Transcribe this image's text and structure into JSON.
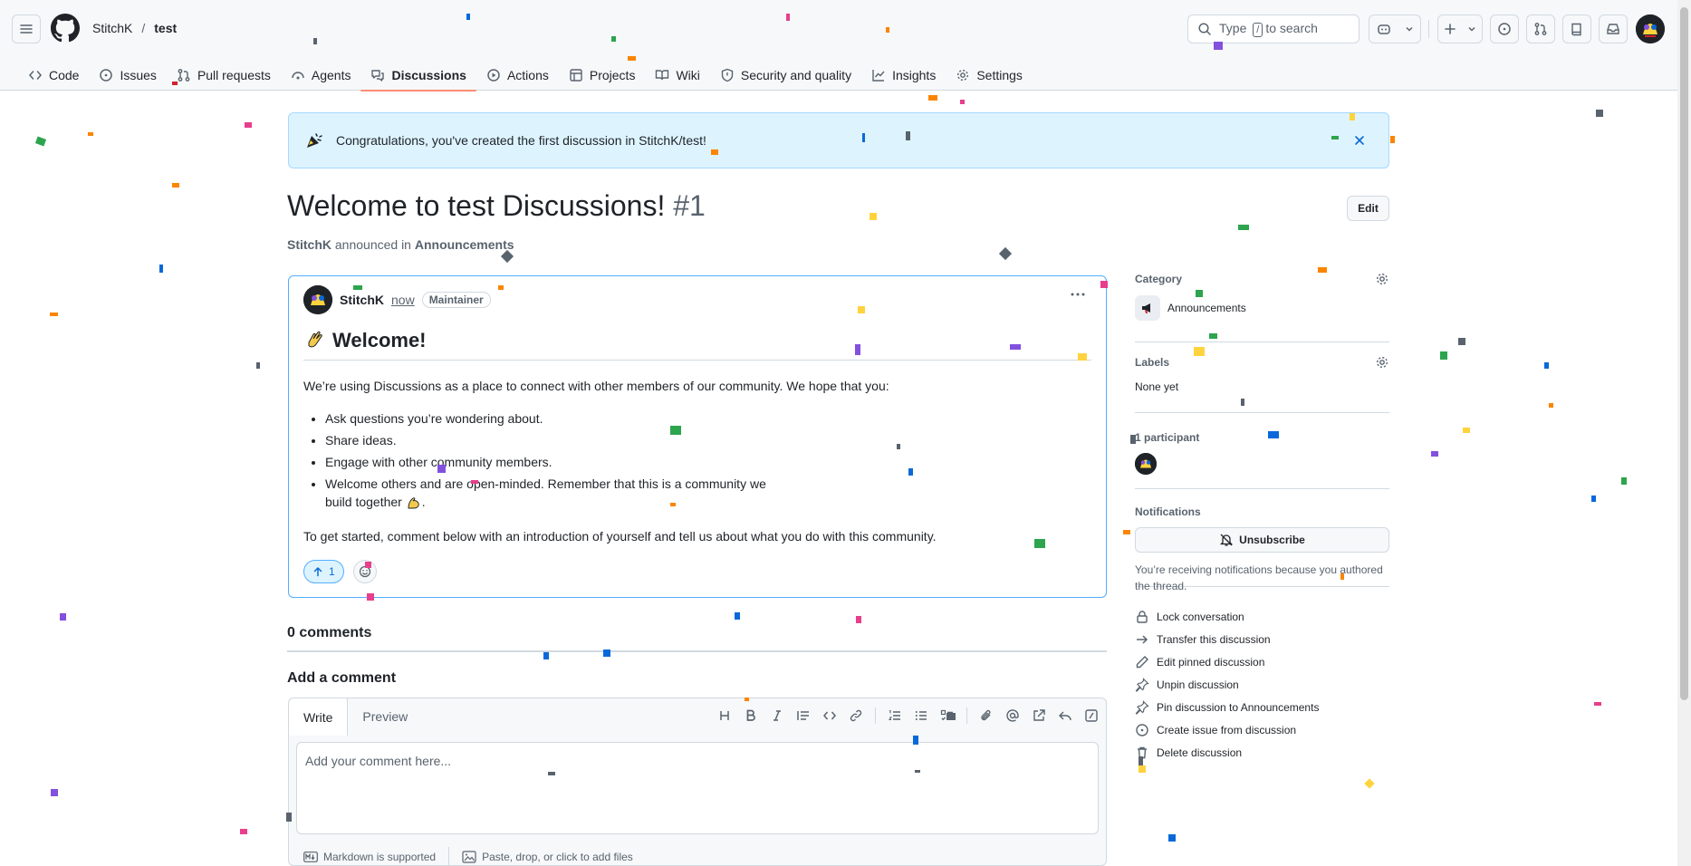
{
  "header": {
    "owner": "StitchK",
    "separator": "/",
    "repo": "test",
    "search": {
      "prefix": "Type",
      "key": "/",
      "suffix": "to search"
    }
  },
  "tabs": [
    {
      "label": "Code",
      "icon": "code-icon"
    },
    {
      "label": "Issues",
      "icon": "issue-icon"
    },
    {
      "label": "Pull requests",
      "icon": "pull-request-icon"
    },
    {
      "label": "Agents",
      "icon": "agent-icon"
    },
    {
      "label": "Discussions",
      "icon": "discussion-icon",
      "active": true
    },
    {
      "label": "Actions",
      "icon": "play-icon"
    },
    {
      "label": "Projects",
      "icon": "table-icon"
    },
    {
      "label": "Wiki",
      "icon": "book-icon"
    },
    {
      "label": "Security and quality",
      "icon": "shield-icon"
    },
    {
      "label": "Insights",
      "icon": "graph-icon"
    },
    {
      "label": "Settings",
      "icon": "gear-icon"
    }
  ],
  "banner": {
    "text": "Congratulations, you've created the first discussion in StitchK/test!"
  },
  "discussion": {
    "title": "Welcome to test Discussions!",
    "number": "#1",
    "edit_label": "Edit",
    "author": "StitchK",
    "action_text": "announced in",
    "category": "Announcements"
  },
  "post": {
    "author": "StitchK",
    "time": "now",
    "badge": "Maintainer",
    "heading": "Welcome!",
    "intro": "We’re using Discussions as a place to connect with other members of our community. We hope that you:",
    "bullets": [
      "Ask questions you’re wondering about.",
      "Share ideas.",
      "Engage with other community members.",
      "Welcome others and are open-minded. Remember that this is a community we build together"
    ],
    "outro": "To get started, comment below with an introduction of yourself and tell us about what you do with this community.",
    "upvotes": "1"
  },
  "comments": {
    "count_label": "0 comments",
    "add_label": "Add a comment",
    "write_tab": "Write",
    "preview_tab": "Preview",
    "placeholder": "Add your comment here...",
    "markdown_note": "Markdown is supported",
    "attach_note": "Paste, drop, or click to add files"
  },
  "sidebar": {
    "category_label": "Category",
    "category_value": "Announcements",
    "labels_label": "Labels",
    "labels_value": "None yet",
    "participants_label": "1 participant",
    "notifications_label": "Notifications",
    "unsubscribe_label": "Unsubscribe",
    "notifications_note": "You’re receiving notifications because you authored the thread.",
    "actions": [
      {
        "label": "Lock conversation",
        "icon": "lock-icon"
      },
      {
        "label": "Transfer this discussion",
        "icon": "arrow-right-icon"
      },
      {
        "label": "Edit pinned discussion",
        "icon": "pencil-icon"
      },
      {
        "label": "Unpin discussion",
        "icon": "pin-icon"
      },
      {
        "label": "Pin discussion to Announcements",
        "icon": "pin-icon"
      },
      {
        "label": "Create issue from discussion",
        "icon": "issue-icon"
      },
      {
        "label": "Delete discussion",
        "icon": "trash-icon"
      }
    ]
  }
}
